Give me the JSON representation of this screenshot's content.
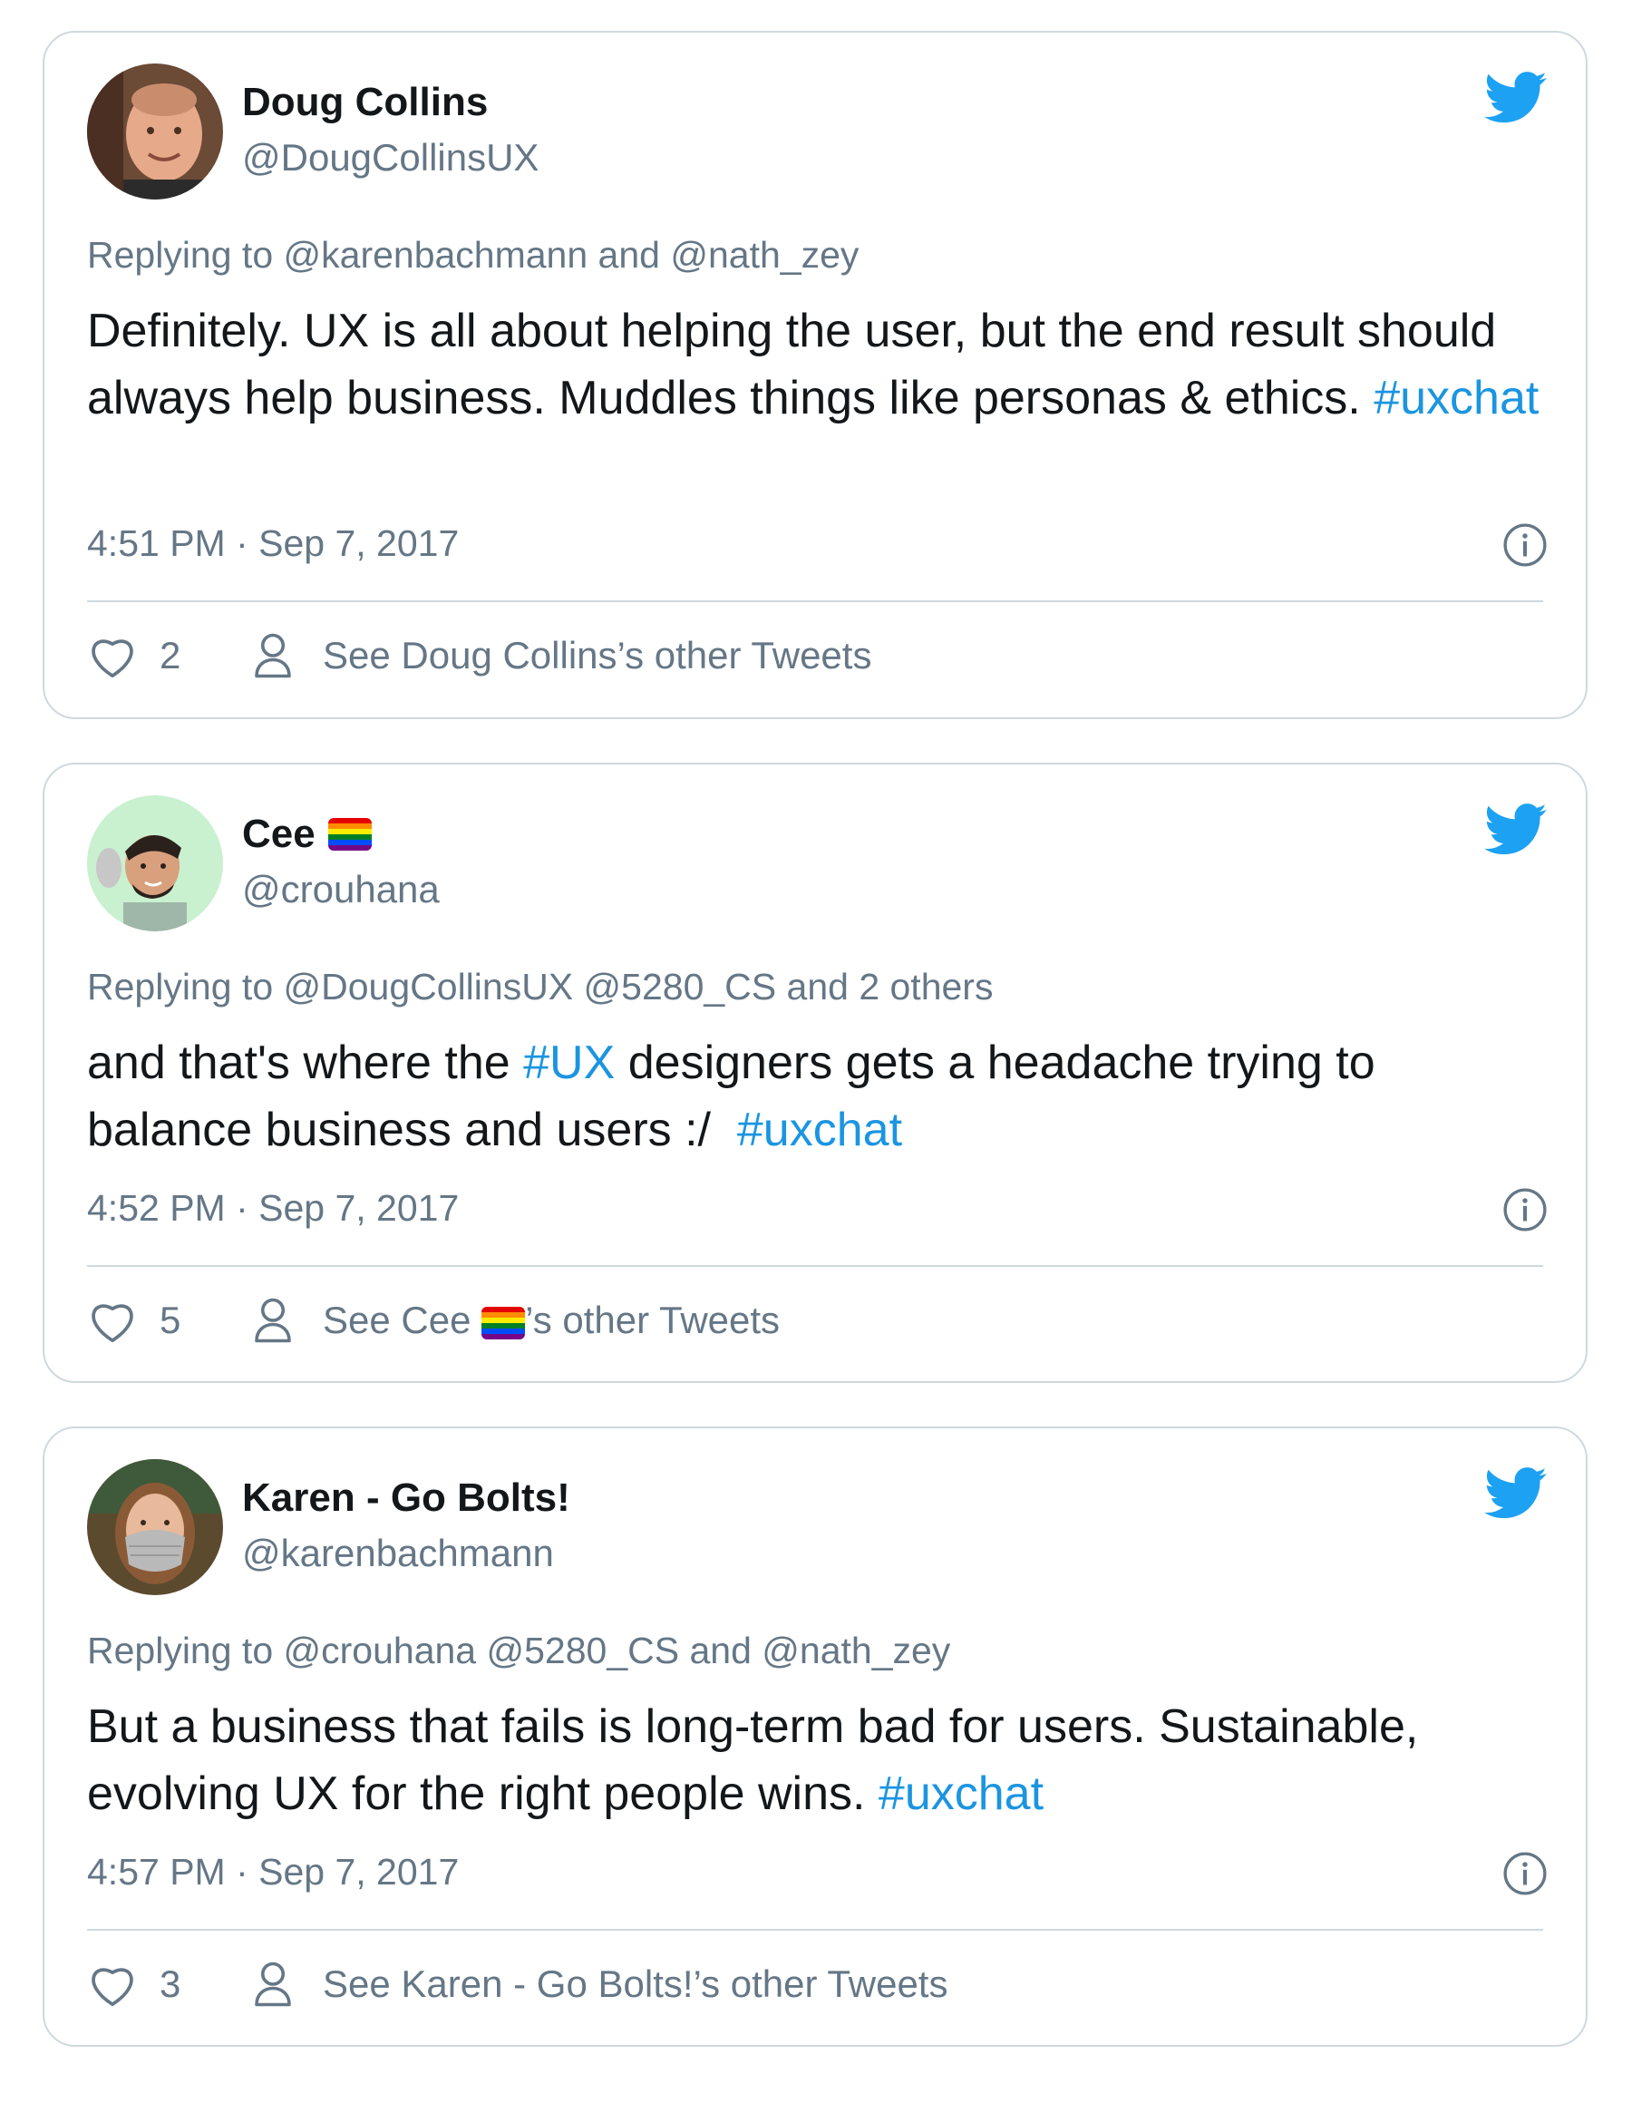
{
  "colors": {
    "link": "#1b95e0",
    "secondary_text": "#657786",
    "border": "#cfd9de",
    "twitter_blue": "#1da1f2"
  },
  "tweets": [
    {
      "name": "Doug Collins",
      "handle": "@DougCollinsUX",
      "replying_prefix": "Replying to ",
      "replying_to": "@karenbachmann and @nath_zey",
      "text": "Definitely. UX is all about helping the user, but the end result should always help business. Muddles things like personas & ethics. ",
      "hashtag": "#uxchat",
      "timestamp": "4:51 PM · Sep 7, 2017",
      "likes": "2",
      "other_tweets": "See Doug Collins’s other Tweets",
      "avatar_icon": "doug-collins-avatar"
    },
    {
      "name": "Cee",
      "name_emoji": "rainbow-flag",
      "handle": "@crouhana",
      "replying_prefix": "Replying to ",
      "replying_to": "@DougCollinsUX @5280_CS and 2 others",
      "text_before": "and that's where the ",
      "hashtag_1": "#UX",
      "text_after": " designers gets a headache trying to balance business and users :/  ",
      "hashtag_2": "#uxchat",
      "timestamp": "4:52 PM · Sep 7, 2017",
      "likes": "5",
      "other_tweets_prefix": "See Cee ",
      "other_tweets_suffix": "’s other Tweets",
      "avatar_icon": "cee-avatar"
    },
    {
      "name": "Karen - Go Bolts!",
      "handle": "@karenbachmann",
      "replying_prefix": "Replying to ",
      "replying_to": "@crouhana @5280_CS and @nath_zey",
      "text": "But a business that fails is long-term bad for users. Sustainable, evolving UX for the right people wins. ",
      "hashtag": "#uxchat",
      "timestamp": "4:57 PM · Sep 7, 2017",
      "likes": "3",
      "other_tweets": "See Karen - Go Bolts!’s other Tweets",
      "avatar_icon": "karen-avatar"
    }
  ]
}
